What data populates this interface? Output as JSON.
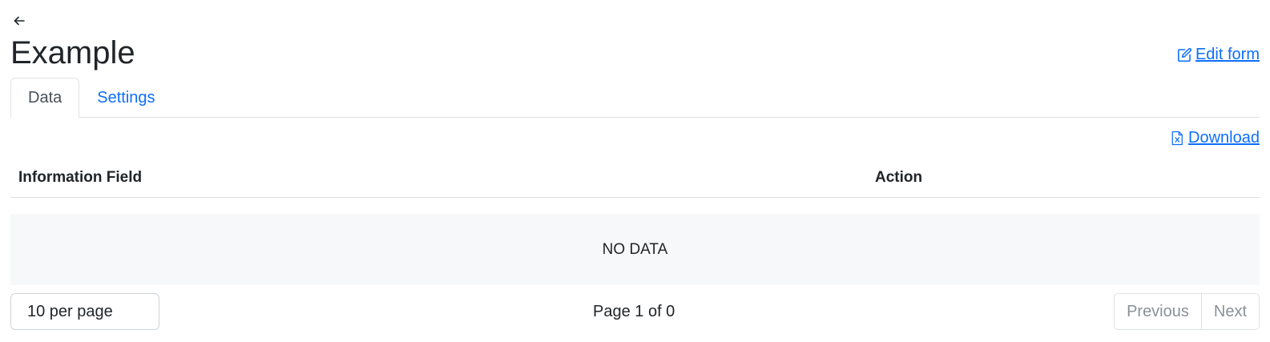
{
  "header": {
    "back_icon": "arrow-left-icon",
    "title": "Example",
    "edit_link": {
      "label": "Edit form",
      "icon": "pencil-square-icon"
    }
  },
  "tabs": [
    {
      "label": "Data",
      "active": true
    },
    {
      "label": "Settings",
      "active": false
    }
  ],
  "toolbar": {
    "download": {
      "label": "Download",
      "icon": "file-excel-icon"
    }
  },
  "table": {
    "columns": [
      "Information Field",
      "Action"
    ],
    "rows": [],
    "empty_text": "NO DATA"
  },
  "pagination": {
    "per_page_label": "10 per page",
    "page_info": "Page 1 of 0",
    "previous_label": "Previous",
    "next_label": "Next"
  },
  "colors": {
    "link": "#0d6efd",
    "text": "#212529",
    "border": "#dee2e6",
    "empty_bg": "#f7f8f9",
    "disabled": "#8a9099"
  }
}
